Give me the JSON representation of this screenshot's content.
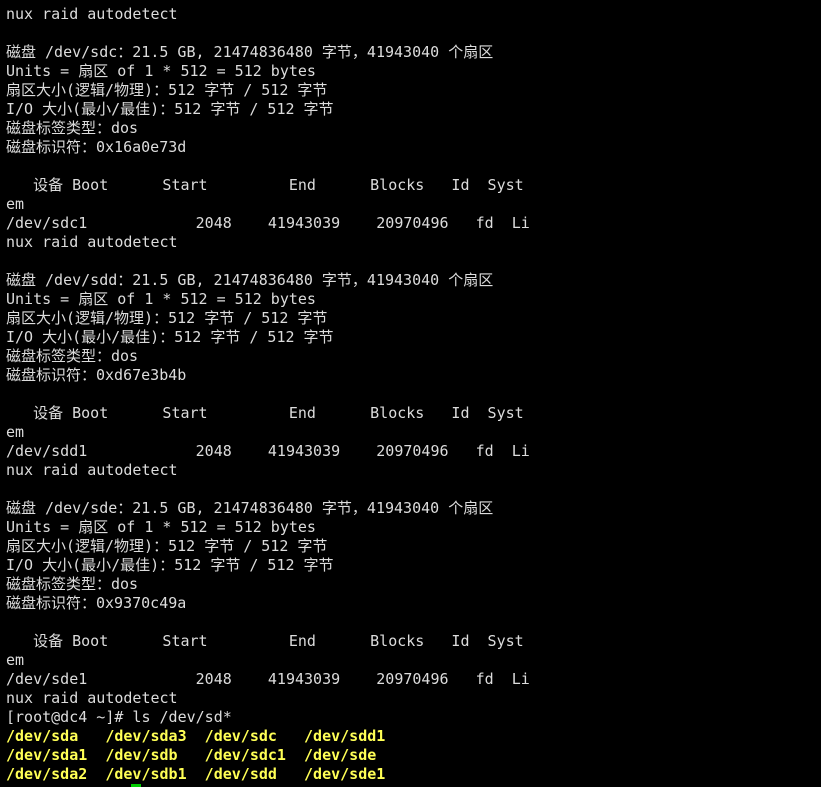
{
  "terminal": {
    "colors": {
      "background": "#000000",
      "text": "#dcdcdc",
      "highlight": "#ffff55",
      "cursor": "#00cc00"
    },
    "lines": [
      {
        "text": "nux raid autodetect",
        "style": "normal"
      },
      {
        "text": "",
        "style": "normal"
      },
      {
        "text": "磁盘 /dev/sdc：21.5 GB, 21474836480 字节，41943040 个扇区",
        "style": "normal"
      },
      {
        "text": "Units = 扇区 of 1 * 512 = 512 bytes",
        "style": "normal"
      },
      {
        "text": "扇区大小(逻辑/物理)：512 字节 / 512 字节",
        "style": "normal"
      },
      {
        "text": "I/O 大小(最小/最佳)：512 字节 / 512 字节",
        "style": "normal"
      },
      {
        "text": "磁盘标签类型：dos",
        "style": "normal"
      },
      {
        "text": "磁盘标识符：0x16a0e73d",
        "style": "normal"
      },
      {
        "text": "",
        "style": "normal"
      },
      {
        "text": "   设备 Boot      Start         End      Blocks   Id  Syst",
        "style": "normal"
      },
      {
        "text": "em",
        "style": "normal"
      },
      {
        "text": "/dev/sdc1            2048    41943039    20970496   fd  Li",
        "style": "normal"
      },
      {
        "text": "nux raid autodetect",
        "style": "normal"
      },
      {
        "text": "",
        "style": "normal"
      },
      {
        "text": "磁盘 /dev/sdd：21.5 GB, 21474836480 字节，41943040 个扇区",
        "style": "normal"
      },
      {
        "text": "Units = 扇区 of 1 * 512 = 512 bytes",
        "style": "normal"
      },
      {
        "text": "扇区大小(逻辑/物理)：512 字节 / 512 字节",
        "style": "normal"
      },
      {
        "text": "I/O 大小(最小/最佳)：512 字节 / 512 字节",
        "style": "normal"
      },
      {
        "text": "磁盘标签类型：dos",
        "style": "normal"
      },
      {
        "text": "磁盘标识符：0xd67e3b4b",
        "style": "normal"
      },
      {
        "text": "",
        "style": "normal"
      },
      {
        "text": "   设备 Boot      Start         End      Blocks   Id  Syst",
        "style": "normal"
      },
      {
        "text": "em",
        "style": "normal"
      },
      {
        "text": "/dev/sdd1            2048    41943039    20970496   fd  Li",
        "style": "normal"
      },
      {
        "text": "nux raid autodetect",
        "style": "normal"
      },
      {
        "text": "",
        "style": "normal"
      },
      {
        "text": "磁盘 /dev/sde：21.5 GB, 21474836480 字节，41943040 个扇区",
        "style": "normal"
      },
      {
        "text": "Units = 扇区 of 1 * 512 = 512 bytes",
        "style": "normal"
      },
      {
        "text": "扇区大小(逻辑/物理)：512 字节 / 512 字节",
        "style": "normal"
      },
      {
        "text": "I/O 大小(最小/最佳)：512 字节 / 512 字节",
        "style": "normal"
      },
      {
        "text": "磁盘标签类型：dos",
        "style": "normal"
      },
      {
        "text": "磁盘标识符：0x9370c49a",
        "style": "normal"
      },
      {
        "text": "",
        "style": "normal"
      },
      {
        "text": "   设备 Boot      Start         End      Blocks   Id  Syst",
        "style": "normal"
      },
      {
        "text": "em",
        "style": "normal"
      },
      {
        "text": "/dev/sde1            2048    41943039    20970496   fd  Li",
        "style": "normal"
      },
      {
        "text": "nux raid autodetect",
        "style": "normal"
      },
      {
        "text": "[root@dc4 ~]# ls /dev/sd*",
        "style": "prompt"
      },
      {
        "text": "/dev/sda   /dev/sda3  /dev/sdc   /dev/sdd1",
        "style": "highlight"
      },
      {
        "text": "/dev/sda1  /dev/sdb   /dev/sdc1  /dev/sde",
        "style": "highlight"
      },
      {
        "text": "/dev/sda2  /dev/sdb1  /dev/sdd   /dev/sde1",
        "style": "highlight"
      }
    ]
  }
}
